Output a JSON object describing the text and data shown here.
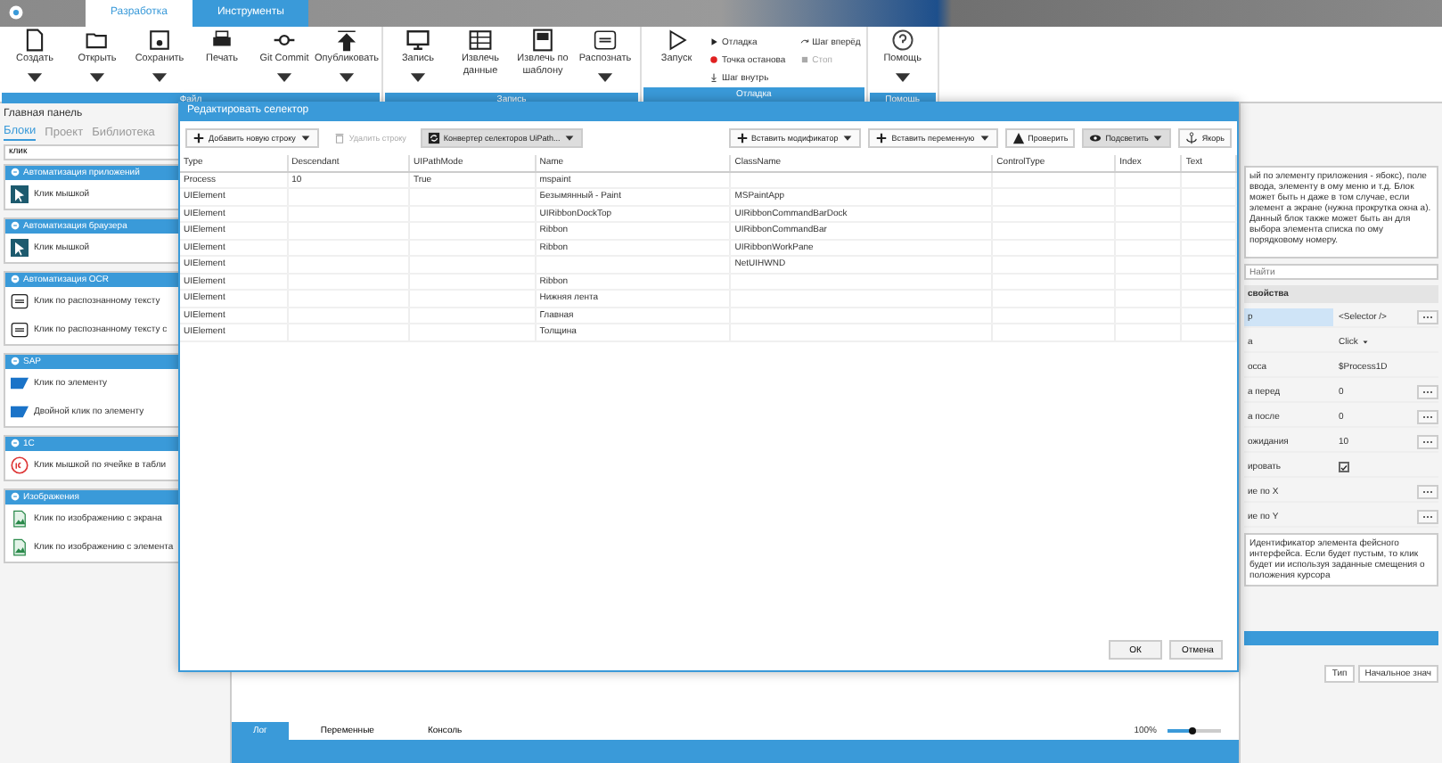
{
  "app_tabs": [
    {
      "label": "Разработка",
      "selected": true
    },
    {
      "label": "Инструменты",
      "selected": false
    }
  ],
  "ribbon": [
    {
      "label": "Файл",
      "buttons": [
        {
          "label": "Создать",
          "kind": "file",
          "dropdown": true
        },
        {
          "label": "Открыть",
          "kind": "folder",
          "dropdown": true
        },
        {
          "label": "Сохранить",
          "kind": "save",
          "dropdown": true
        },
        {
          "label": "Печать",
          "kind": "print",
          "dropdown": false
        },
        {
          "label": "Git Commit",
          "kind": "git",
          "dropdown": true
        },
        {
          "label": "Опубликовать",
          "kind": "publish",
          "dropdown": true
        }
      ]
    },
    {
      "label": "Запись",
      "buttons": [
        {
          "label": "Запись",
          "kind": "monitor",
          "dropdown": true
        },
        {
          "label": "Извлечь данные",
          "kind": "table",
          "dropdown": false
        },
        {
          "label": "Извлечь по шаблону",
          "kind": "template",
          "dropdown": false
        },
        {
          "label": "Распознать",
          "kind": "ocr",
          "dropdown": true
        }
      ]
    },
    {
      "label": "Отладка",
      "buttons": [
        {
          "label": "Запуск",
          "kind": "run",
          "dropdown": false
        }
      ],
      "small_items": [
        {
          "label": "Отладка",
          "kind": "play",
          "disabled": false
        },
        {
          "label": "Шаг вперёд",
          "kind": "step",
          "disabled": false
        },
        {
          "label": "Точка останова",
          "kind": "breakpoint",
          "disabled": false
        },
        {
          "label": "Стоп",
          "kind": "stop",
          "disabled": true
        },
        {
          "label": "Шаг внутрь",
          "kind": "stepin",
          "disabled": false
        }
      ]
    },
    {
      "label": "Помощь",
      "buttons": [
        {
          "label": "Помощь",
          "kind": "help",
          "dropdown": true
        }
      ]
    }
  ],
  "left_panel": {
    "title": "Главная панель",
    "tabs": [
      {
        "label": "Блоки",
        "selected": true
      },
      {
        "label": "Проект",
        "selected": false
      },
      {
        "label": "Библиотека",
        "selected": false
      }
    ],
    "search": {
      "value": "клик"
    },
    "sections": [
      {
        "title": "Автоматизация приложений",
        "items": [
          {
            "label": "Клик мышкой",
            "kind": "cursor"
          }
        ]
      },
      {
        "title": "Автоматизация браузера",
        "items": [
          {
            "label": "Клик мышкой",
            "kind": "cursor"
          }
        ]
      },
      {
        "title": "Автоматизация OCR",
        "items": [
          {
            "label": "Клик по распознанному тексту",
            "kind": "ocr"
          },
          {
            "label": "Клик по распознанному тексту с",
            "kind": "ocr"
          }
        ]
      },
      {
        "title": "SAP",
        "items": [
          {
            "label": "Клик по элементу",
            "kind": "sap"
          },
          {
            "label": "Двойной клик по элементу",
            "kind": "sap"
          }
        ]
      },
      {
        "title": "1С",
        "items": [
          {
            "label": "Клик мышкой по ячейке в табли",
            "kind": "onec"
          }
        ]
      },
      {
        "title": "Изображения",
        "items": [
          {
            "label": "Клик по изображению с экрана",
            "kind": "image"
          },
          {
            "label": "Клик по изображению с элемента",
            "kind": "image"
          }
        ]
      }
    ]
  },
  "dialog": {
    "title": "Редактировать селектор",
    "toolbar_left": [
      {
        "label": "Добавить новую строку",
        "kind": "add",
        "dropdown": true,
        "disabled": false,
        "pressed": false
      },
      {
        "label": "Удалить строку",
        "kind": "delete",
        "dropdown": false,
        "disabled": true,
        "pressed": false
      },
      {
        "label": "Конвертер селекторов UiPath...",
        "kind": "convert",
        "dropdown": true,
        "disabled": false,
        "pressed": true
      }
    ],
    "toolbar_right": [
      {
        "label": "Вставить модификатор",
        "kind": "add",
        "dropdown": true,
        "disabled": false,
        "pressed": false
      },
      {
        "label": "Вставить переменную",
        "kind": "add",
        "dropdown": true,
        "disabled": false,
        "pressed": false
      },
      {
        "label": "Проверить",
        "kind": "warning",
        "dropdown": false,
        "disabled": false,
        "pressed": false
      },
      {
        "label": "Подсветить",
        "kind": "eye",
        "dropdown": true,
        "disabled": false,
        "pressed": true
      },
      {
        "label": "Якорь",
        "kind": "anchor",
        "dropdown": false,
        "disabled": false,
        "pressed": false
      }
    ],
    "table": {
      "columns": [
        "Type",
        "Descendant",
        "UIPathMode",
        "Name",
        "ClassName",
        "ControlType",
        "Index",
        "Text"
      ],
      "rows": [
        [
          "Process",
          "10",
          "True",
          "mspaint",
          "",
          "",
          "",
          ""
        ],
        [
          "UIElement",
          "",
          "",
          "Безымянный - Paint",
          "MSPaintApp",
          "",
          "",
          ""
        ],
        [
          "UIElement",
          "",
          "",
          "UIRibbonDockTop",
          "UIRibbonCommandBarDock",
          "",
          "",
          ""
        ],
        [
          "UIElement",
          "",
          "",
          "Ribbon",
          "UIRibbonCommandBar",
          "",
          "",
          ""
        ],
        [
          "UIElement",
          "",
          "",
          "Ribbon",
          "UIRibbonWorkPane",
          "",
          "",
          ""
        ],
        [
          "UIElement",
          "",
          "",
          "",
          "NetUIHWND",
          "",
          "",
          ""
        ],
        [
          "UIElement",
          "",
          "",
          "Ribbon",
          "",
          "",
          "",
          ""
        ],
        [
          "UIElement",
          "",
          "",
          "Нижняя лента",
          "",
          "",
          "",
          ""
        ],
        [
          "UIElement",
          "",
          "",
          "Главная",
          "",
          "",
          "",
          ""
        ],
        [
          "UIElement",
          "",
          "",
          "Толщина",
          "",
          "",
          "",
          ""
        ]
      ]
    },
    "buttons": [
      "ОК",
      "Отмена"
    ]
  },
  "right_panel": {
    "description": "ый по элементу приложения - ябокс), поле ввода, элементу в ому меню и т.д. Блок может быть н даже в том случае, если элемент а экране (нужна прокрутка окна а). Данный блок также может быть ан для выбора элемента списка по ому порядковому номеру.",
    "search": {
      "placeholder": "Найти"
    },
    "properties_title": "свойства",
    "properties": [
      {
        "label": "р",
        "value": "<Selector />",
        "kind": "selector",
        "selected": true
      },
      {
        "label": "а",
        "value": "Click",
        "kind": "dropdown",
        "selected": false
      },
      {
        "label": "осса",
        "value": "$Process1D",
        "kind": "text",
        "selected": false
      },
      {
        "label": "а перед",
        "value": "0",
        "kind": "button",
        "selected": false
      },
      {
        "label": "а после",
        "value": "0",
        "kind": "button",
        "selected": false
      },
      {
        "label": "ожидания",
        "value": "10",
        "kind": "button",
        "selected": false
      },
      {
        "label": "ировать",
        "kind": "checkbox",
        "checked": true,
        "selected": false
      },
      {
        "label": "ие по X",
        "kind": "button",
        "selected": false
      },
      {
        "label": "ие по Y",
        "kind": "button",
        "selected": false
      }
    ],
    "help": "Идентификатор элемента фейсного интерфейса. Если будет пустым, то клик будет ии используя заданные смещения о положения курсора",
    "vars_columns": [
      "Тип",
      "Начальное знач"
    ]
  },
  "bottom": {
    "tabs": [
      {
        "label": "Лог",
        "selected": true
      },
      {
        "label": "Переменные",
        "selected": false
      },
      {
        "label": "Консоль",
        "selected": false
      }
    ],
    "zoom": {
      "reading": "100%",
      "level": 0.45
    }
  }
}
